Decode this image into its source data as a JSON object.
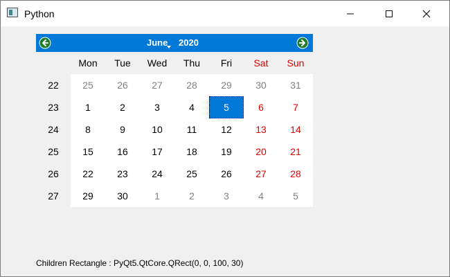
{
  "window": {
    "title": "Python",
    "icon": "python-app-icon",
    "controls": [
      "minimize-icon",
      "maximize-icon",
      "close-icon"
    ]
  },
  "calendar": {
    "month": "June",
    "year": "2020",
    "prev_icon": "arrow-left-icon",
    "next_icon": "arrow-right-icon",
    "accent_color": "#0078d7",
    "weekend_color": "#dd0000",
    "day_names": [
      "Mon",
      "Tue",
      "Wed",
      "Thu",
      "Fri",
      "Sat",
      "Sun"
    ],
    "weeks": [
      {
        "week": "22",
        "days": [
          "25",
          "26",
          "27",
          "28",
          "29",
          "30",
          "31"
        ]
      },
      {
        "week": "23",
        "days": [
          "1",
          "2",
          "3",
          "4",
          "5",
          "6",
          "7"
        ]
      },
      {
        "week": "24",
        "days": [
          "8",
          "9",
          "10",
          "11",
          "12",
          "13",
          "14"
        ]
      },
      {
        "week": "25",
        "days": [
          "15",
          "16",
          "17",
          "18",
          "19",
          "20",
          "21"
        ]
      },
      {
        "week": "26",
        "days": [
          "22",
          "23",
          "24",
          "25",
          "26",
          "27",
          "28"
        ]
      },
      {
        "week": "27",
        "days": [
          "29",
          "30",
          "1",
          "2",
          "3",
          "4",
          "5"
        ]
      }
    ],
    "selected_day": "5"
  },
  "status": {
    "text": "Children Rectangle : PyQt5.QtCore.QRect(0, 0, 100, 30)"
  }
}
